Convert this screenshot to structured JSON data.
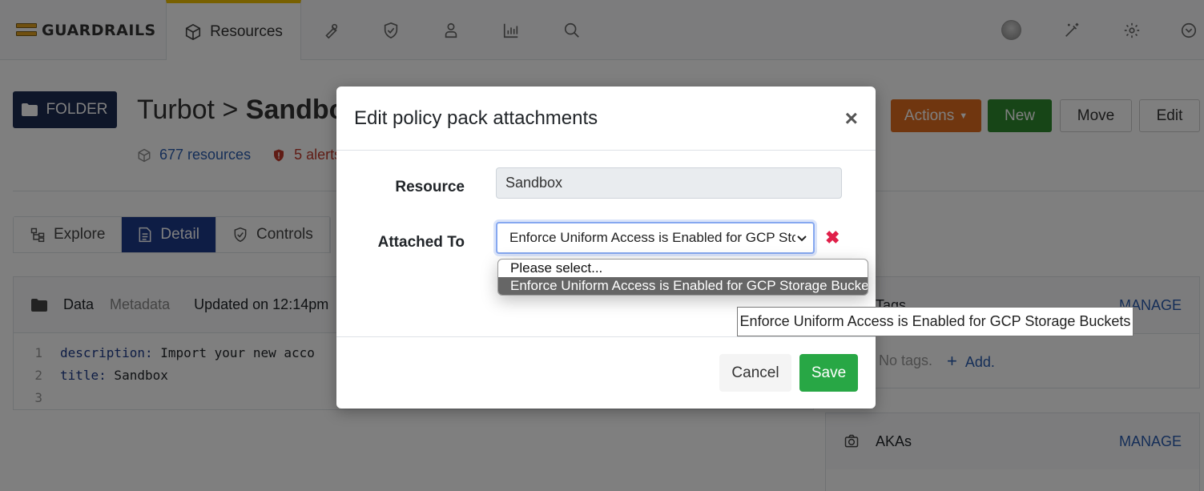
{
  "nav": {
    "brand": "GUARDRAILS",
    "tabs": [
      {
        "label": "Resources",
        "icon": "cube-icon"
      },
      {
        "label": "",
        "icon": "wrench-icon"
      },
      {
        "label": "",
        "icon": "shield-check-icon"
      },
      {
        "label": "",
        "icon": "user-icon"
      },
      {
        "label": "",
        "icon": "bar-chart-icon"
      },
      {
        "label": "",
        "icon": "search-icon"
      }
    ],
    "right_icons": [
      "avatar",
      "magic-wand-icon",
      "gear-icon",
      "chevron-down-circle-icon"
    ]
  },
  "page": {
    "folder_label": "FOLDER",
    "title_prefix": "Turbot > ",
    "title_bold": "Sandbo",
    "resources_count": "677 resources",
    "alerts_count": "5 alerts",
    "actions": {
      "actions": "Actions",
      "new": "New",
      "move": "Move",
      "edit": "Edit"
    },
    "tabs": [
      "Explore",
      "Detail",
      "Controls"
    ],
    "active_tab": "Detail"
  },
  "data_panel": {
    "tab_data": "Data",
    "tab_metadata": "Metadata",
    "updated": "Updated on 12:14pm",
    "lines": [
      {
        "no": "1",
        "key": "description:",
        "value": " Import your new acco"
      },
      {
        "no": "2",
        "key": "title:",
        "value": " Sandbox"
      },
      {
        "no": "3",
        "key": "",
        "value": ""
      }
    ]
  },
  "tags_panel": {
    "title": "Tags",
    "manage": "MANAGE",
    "empty": "No tags.",
    "add": "Add."
  },
  "akas_panel": {
    "title": "AKAs",
    "manage": "MANAGE"
  },
  "modal": {
    "title": "Edit policy pack attachments",
    "close": "×",
    "resource_label": "Resource",
    "resource_value": "Sandbox",
    "attached_label": "Attached To",
    "attached_value": "Enforce Uniform Access is Enabled for GCP Stora",
    "remove": "✖",
    "cancel": "Cancel",
    "save": "Save"
  },
  "dropdown": {
    "options": [
      "Please select...",
      "Enforce Uniform Access is Enabled for GCP Storage Buckets"
    ],
    "selected_index": 1
  },
  "tooltip": "Enforce Uniform Access is Enabled for GCP Storage Buckets",
  "colors": {
    "folder": "#1d2d52",
    "active_tab": "#1d3a8a",
    "actions": "#e06c1e",
    "new": "#2e8b2e",
    "save": "#28a745",
    "remove": "#e0204a",
    "link": "#2a5db0"
  }
}
